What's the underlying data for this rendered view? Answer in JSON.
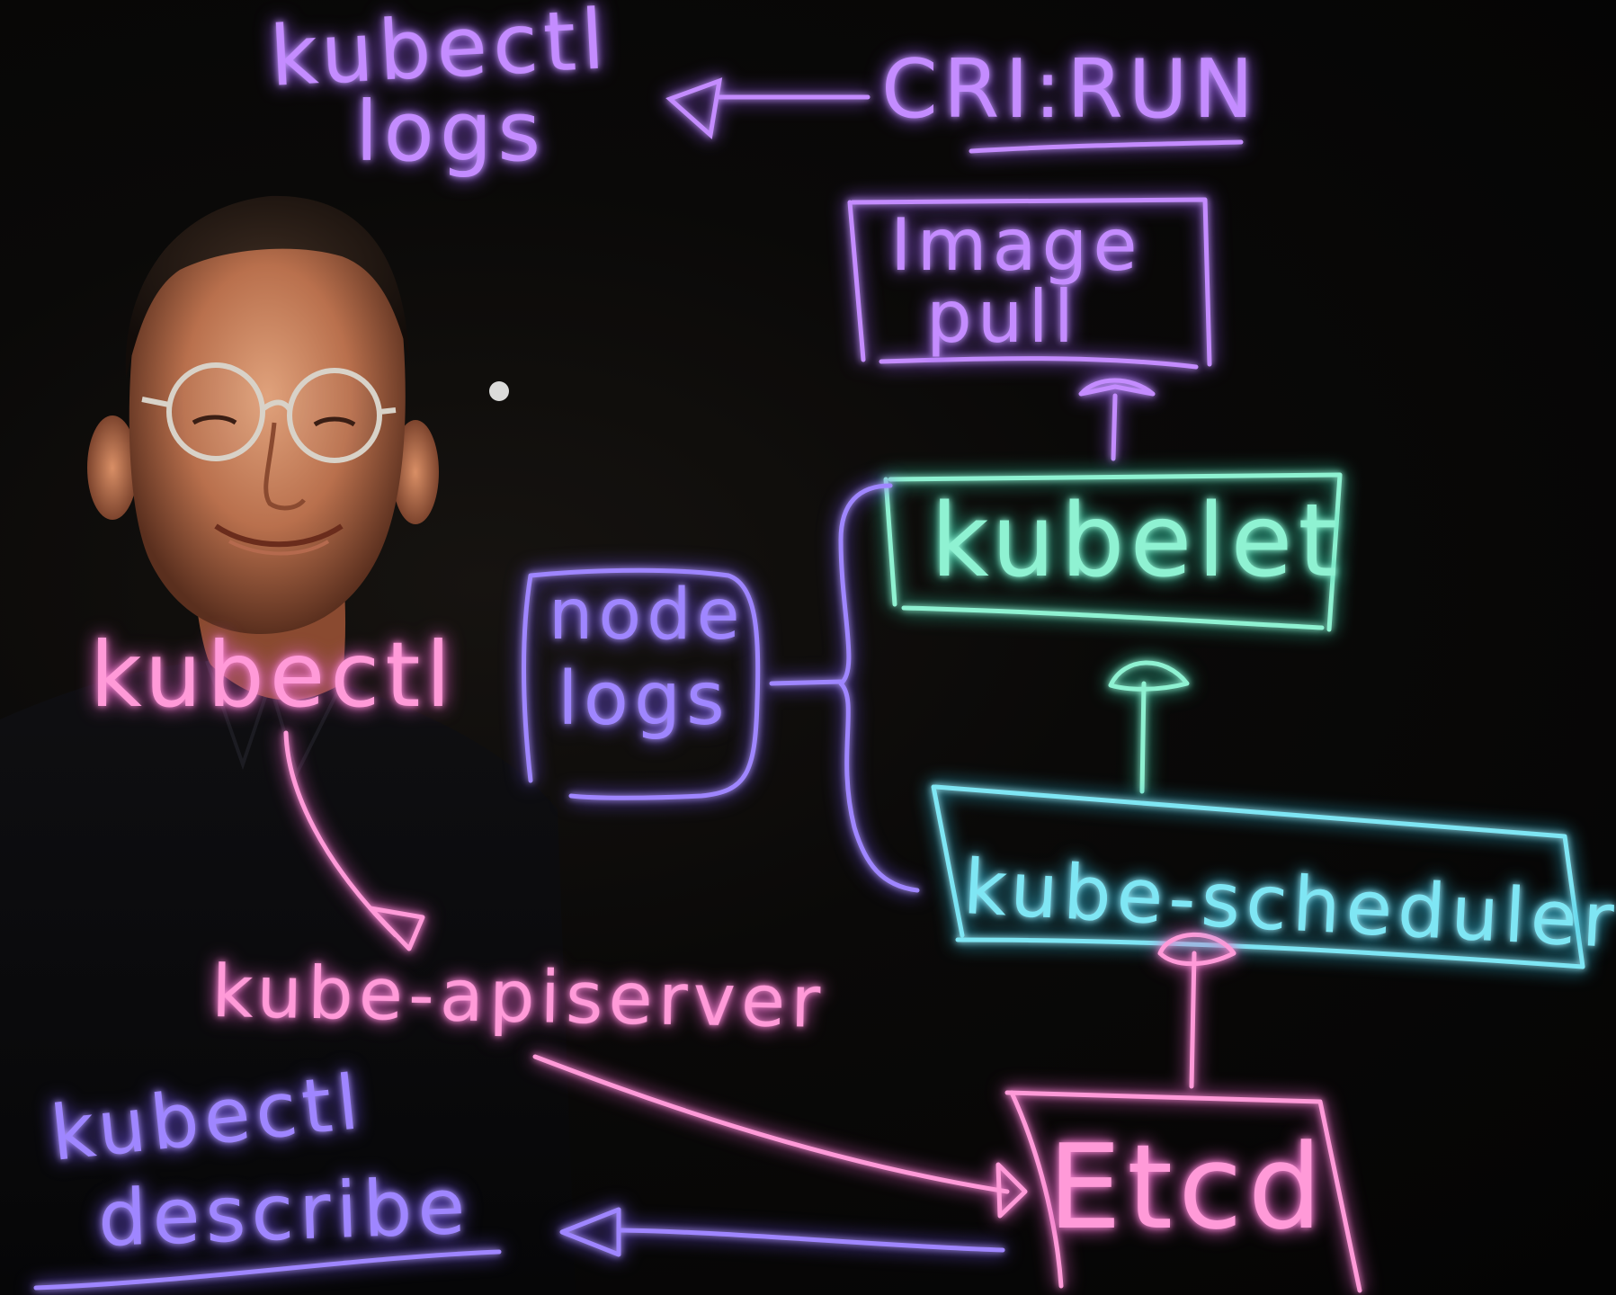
{
  "colors": {
    "pink": "#ff9ad8",
    "purple": "#c48cff",
    "violet": "#9f86ff",
    "teal": "#8ff2d2",
    "cyan": "#7fe6f4"
  },
  "labels": {
    "kubectl_logs_line1": "kubectl",
    "kubectl_logs_line2": "logs",
    "cri_run": "CRI:RUN",
    "image_pull_line1": "Image",
    "image_pull_line2": "pull",
    "kubelet": "kubelet",
    "node_logs_line1": "node",
    "node_logs_line2": "logs",
    "kubectl": "kubectl",
    "kube_scheduler": "kube-scheduler",
    "kube_apiserver": "kube-apiserver",
    "kubectl_describe_line1": "kubectl",
    "kubectl_describe_line2": "describe",
    "etcd": "Etcd"
  }
}
